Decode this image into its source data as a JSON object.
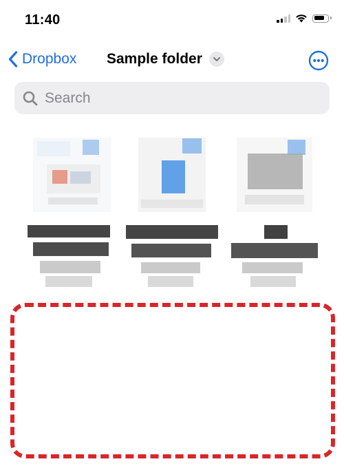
{
  "status_bar": {
    "time": "11:40"
  },
  "nav": {
    "back_label": "Dropbox",
    "title": "Sample folder",
    "accent_color": "#1f6fe0",
    "back_icon": "chevron-left-icon",
    "title_menu_icon": "chevron-down-icon",
    "more_icon": "ellipsis-circle-icon"
  },
  "search": {
    "placeholder": "Search",
    "value": "",
    "icon": "search-icon"
  },
  "files": [
    {
      "thumbnail": "document-thumbnail",
      "accent": "#e0573a"
    },
    {
      "thumbnail": "document-thumbnail",
      "accent": "#2f86e4"
    },
    {
      "thumbnail": "document-thumbnail",
      "accent": "#9a9a9a"
    }
  ],
  "annotation": {
    "color": "#d8262a",
    "style": "dashed"
  }
}
